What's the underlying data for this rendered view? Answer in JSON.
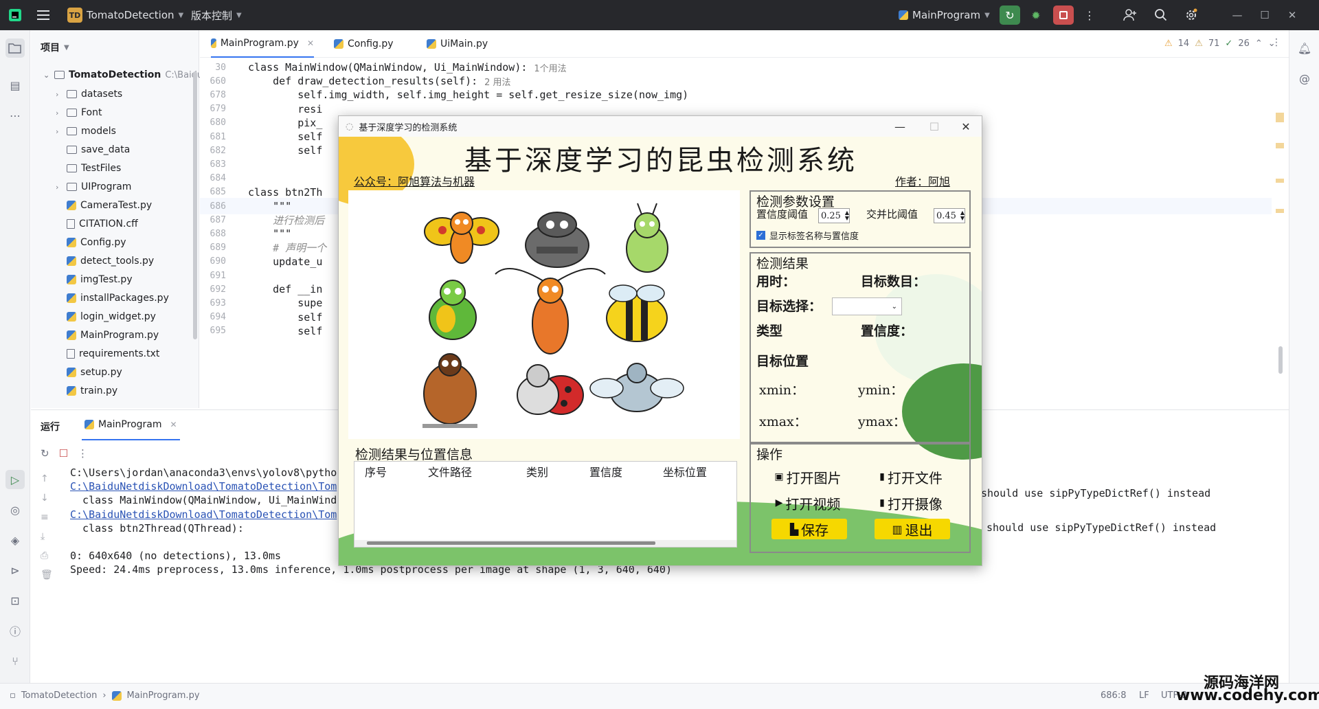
{
  "titlebar": {
    "project_badge": "TD",
    "project_name": "TomatoDetection",
    "vcs_label": "版本控制",
    "run_config": "MainProgram"
  },
  "project_panel": {
    "title": "项目",
    "root": "TomatoDetection",
    "root_path": "C:\\BaiduN",
    "items": [
      {
        "label": "datasets",
        "type": "folder",
        "expandable": true
      },
      {
        "label": "Font",
        "type": "folder",
        "expandable": true
      },
      {
        "label": "models",
        "type": "folder",
        "expandable": true
      },
      {
        "label": "save_data",
        "type": "folder",
        "expandable": false
      },
      {
        "label": "TestFiles",
        "type": "folder",
        "expandable": false
      },
      {
        "label": "UIProgram",
        "type": "folder",
        "expandable": true
      },
      {
        "label": "CameraTest.py",
        "type": "py"
      },
      {
        "label": "CITATION.cff",
        "type": "txt"
      },
      {
        "label": "Config.py",
        "type": "py"
      },
      {
        "label": "detect_tools.py",
        "type": "py"
      },
      {
        "label": "imgTest.py",
        "type": "py"
      },
      {
        "label": "installPackages.py",
        "type": "py"
      },
      {
        "label": "login_widget.py",
        "type": "py"
      },
      {
        "label": "MainProgram.py",
        "type": "py"
      },
      {
        "label": "requirements.txt",
        "type": "txt"
      },
      {
        "label": "setup.py",
        "type": "py"
      },
      {
        "label": "train.py",
        "type": "py"
      }
    ]
  },
  "editor": {
    "tabs": [
      {
        "label": "MainProgram.py",
        "active": true
      },
      {
        "label": "Config.py",
        "active": false
      },
      {
        "label": "UiMain.py",
        "active": false
      }
    ],
    "inspections": {
      "warnings": "14",
      "weak": "71",
      "ok": "26"
    },
    "lines": [
      {
        "num": "30",
        "code": "class MainWindow(QMainWindow, Ui_MainWindow):",
        "hint": "1个用法"
      },
      {
        "num": "660",
        "code": "    def draw_detection_results(self):",
        "hint": "2 用法"
      },
      {
        "num": "678",
        "code": "        self.img_width, self.img_height = self.get_resize_size(now_img)",
        "hint": ""
      },
      {
        "num": "679",
        "code": "        resi",
        "hint": ""
      },
      {
        "num": "680",
        "code": "        pix_",
        "hint": ""
      },
      {
        "num": "681",
        "code": "        self",
        "hint": ""
      },
      {
        "num": "682",
        "code": "        self",
        "hint": ""
      },
      {
        "num": "683",
        "code": "",
        "hint": ""
      },
      {
        "num": "684",
        "code": "",
        "hint": ""
      },
      {
        "num": "685",
        "code": "class btn2Th",
        "hint": ""
      },
      {
        "num": "686",
        "code": "    \"\"\"",
        "hint": ""
      },
      {
        "num": "687",
        "code": "    进行检测后",
        "hint": ""
      },
      {
        "num": "688",
        "code": "    \"\"\"",
        "hint": ""
      },
      {
        "num": "689",
        "code": "    # 声明一个",
        "hint": ""
      },
      {
        "num": "690",
        "code": "    update_u",
        "hint": ""
      },
      {
        "num": "691",
        "code": "",
        "hint": ""
      },
      {
        "num": "692",
        "code": "    def __in",
        "hint": ""
      },
      {
        "num": "693",
        "code": "        supe",
        "hint": ""
      },
      {
        "num": "694",
        "code": "        self",
        "hint": ""
      },
      {
        "num": "695",
        "code": "        self",
        "hint": ""
      }
    ]
  },
  "run_panel": {
    "label": "运行",
    "tab": "MainProgram",
    "lines": [
      {
        "text": "C:\\Users\\jordan\\anaconda3\\envs\\yolov8\\pytho",
        "style": "normal"
      },
      {
        "text": "C:\\BaiduNetdiskDownload\\TomatoDetection\\Tom",
        "style": "link"
      },
      {
        "text": "  class MainWindow(QMainWindow, Ui_MainWind",
        "style": "normal"
      },
      {
        "text": "C:\\BaiduNetdiskDownload\\TomatoDetection\\Tom",
        "style": "link"
      },
      {
        "text": "  class btn2Thread(QThread):",
        "style": "normal"
      },
      {
        "text": "",
        "style": "normal"
      },
      {
        "text": "0: 640x640 (no detections), 13.0ms",
        "style": "normal"
      },
      {
        "text": "Speed: 24.4ms preprocess, 13.0ms inference, 1.0ms postprocess per image at shape (1, 3, 640, 640)",
        "style": "normal"
      }
    ],
    "right_msgs": [
      "should use sipPyTypeDictRef() instead",
      "should use sipPyTypeDictRef() instead"
    ]
  },
  "statusbar": {
    "crumb_project": "TomatoDetection",
    "crumb_file": "MainProgram.py",
    "position": "686:8",
    "line_sep": "LF",
    "encoding": "UTF-8"
  },
  "watermark": {
    "line1": "源码海洋网",
    "line2": "www.codehy.com"
  },
  "app": {
    "window_title": "基于深度学习的检测系统",
    "main_title": "基于深度学习的昆虫检测系统",
    "official_account": "公众号：阿旭算法与机器",
    "author": "作者：阿旭",
    "params": {
      "title": "检测参数设置",
      "conf_label": "置信度阈值",
      "conf_value": "0.25",
      "iou_label": "交并比阈值",
      "iou_value": "0.45",
      "show_labels": "显示标签名称与置信度",
      "show_labels_checked": true
    },
    "results": {
      "title": "检测结果",
      "time_label": "用时：",
      "count_label": "目标数目：",
      "select_label": "目标选择：",
      "select_value": "",
      "type_label": "类型",
      "conf_label": "置信度：",
      "pos_label": "目标位置",
      "xmin_label": "xmin：",
      "ymin_label": "ymin：",
      "xmax_label": "xmax：",
      "ymax_label": "ymax："
    },
    "table": {
      "title": "检测结果与位置信息",
      "headers": [
        "序号",
        "文件路径",
        "类别",
        "置信度",
        "坐标位置"
      ]
    },
    "ops": {
      "title": "操作",
      "open_image": "打开图片",
      "open_folder": "打开文件",
      "open_video": "打开视频",
      "open_camera": "打开摄像",
      "save": "保存",
      "exit": "退出"
    }
  }
}
